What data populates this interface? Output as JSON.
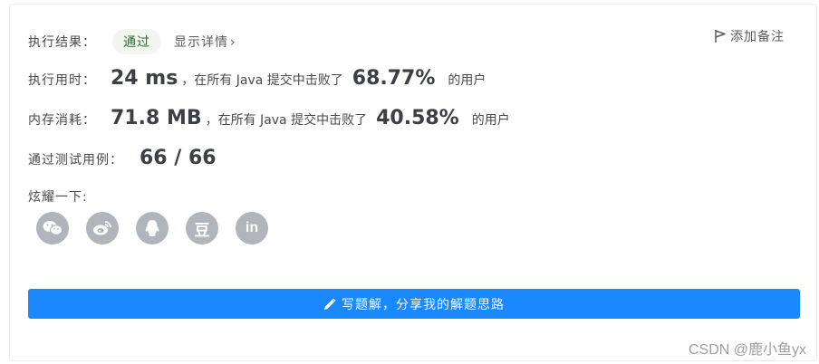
{
  "result": {
    "label": "执行结果：",
    "status": "通过",
    "details_link": "显示详情",
    "details_chevron": "›",
    "add_note": "添加备注"
  },
  "runtime": {
    "label": "执行用时：",
    "value": "24 ms",
    "text_before": "，在所有 Java 提交中击败了",
    "percent": "68.77%",
    "text_after": "的用户"
  },
  "memory": {
    "label": "内存消耗：",
    "value": "71.8 MB",
    "text_before": "，在所有 Java 提交中击败了",
    "percent": "40.58%",
    "text_after": "的用户"
  },
  "testcases": {
    "label": "通过测试用例：",
    "value": "66 / 66"
  },
  "share": {
    "label": "炫耀一下:",
    "icons": [
      "wechat-icon",
      "weibo-icon",
      "qq-icon",
      "douban-icon",
      "linkedin-icon"
    ],
    "douban_glyph": "豆",
    "linkedin_glyph": "in"
  },
  "solution_button": "写题解，分享我的解题思路",
  "watermark": "CSDN @鹿小鱼yx",
  "colors": {
    "primary": "#1a88ff",
    "badge_bg": "#f1f7ef",
    "icon_bg": "#b0b4bb"
  }
}
